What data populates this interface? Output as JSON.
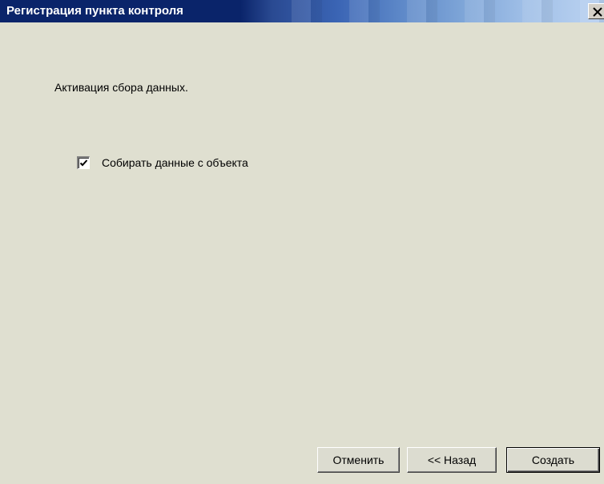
{
  "window": {
    "title": "Регистрация пункта контроля",
    "close_glyph": "X"
  },
  "content": {
    "heading": "Активация сбора данных.",
    "checkbox": {
      "label": "Собирать данные с объекта",
      "checked": true
    }
  },
  "buttons": {
    "cancel": "Отменить",
    "back": "<< Назад",
    "create": "Создать"
  },
  "icons": {
    "close": "close-icon",
    "check": "check-icon"
  },
  "colors": {
    "title_bar": "#0a246a",
    "title_text": "#ffffff",
    "dialog_bg": "#dfdfd0"
  }
}
